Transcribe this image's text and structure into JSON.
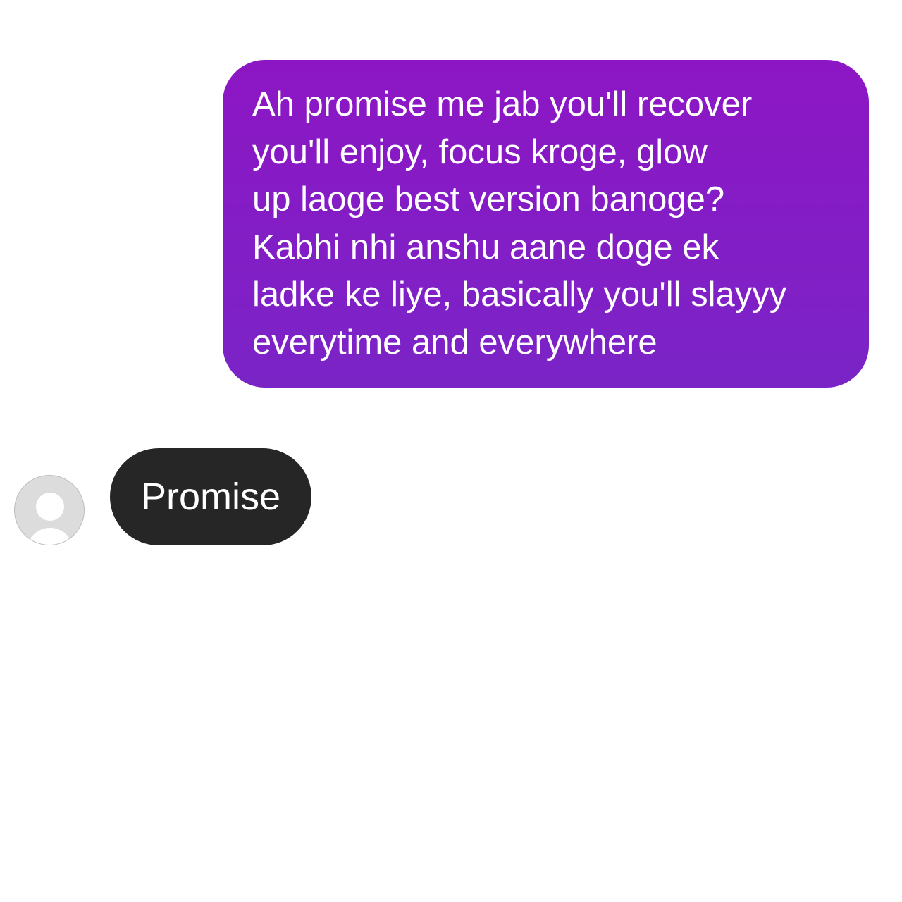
{
  "conversation": {
    "sent_message": {
      "lines": [
        "Ah promise me jab you'll recover",
        "you'll enjoy, focus kroge, glow",
        "up laoge best version banoge?",
        "Kabhi nhi anshu aane doge ek",
        "ladke ke liye, basically you'll slayyy",
        "everytime and everywhere"
      ]
    },
    "received_message": {
      "text": "Promise",
      "avatar_icon": "default-user-avatar-icon"
    }
  },
  "colors": {
    "sent_bubble_top": "#8d16c4",
    "sent_bubble_bottom": "#7a24c6",
    "received_bubble": "#262626",
    "avatar_bg": "#dcdcdc",
    "background": "#ffffff"
  }
}
